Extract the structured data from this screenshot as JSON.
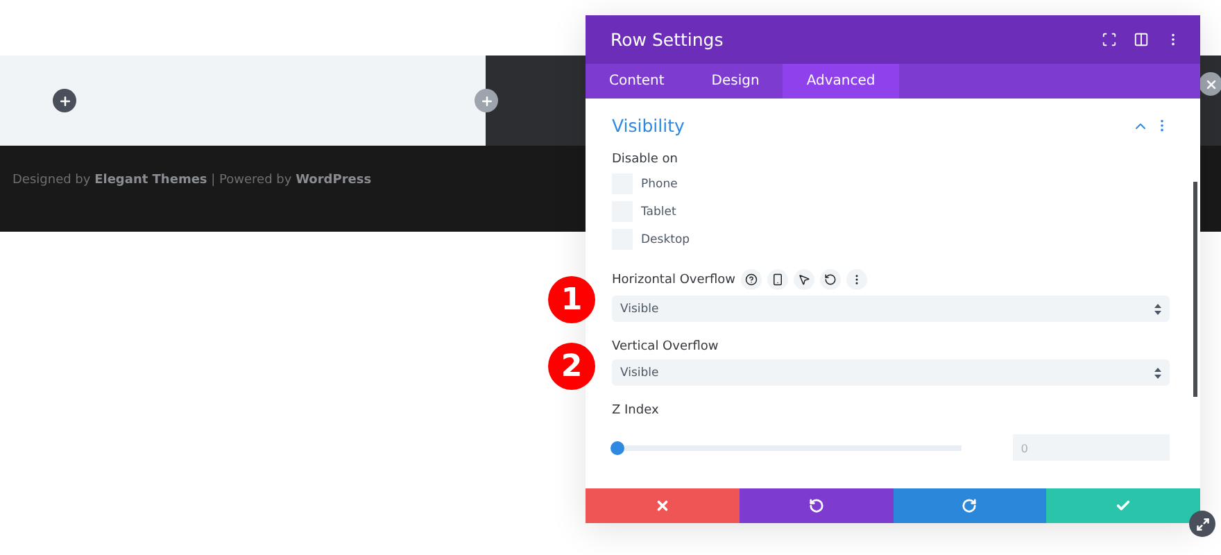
{
  "page": {
    "footer_text": "Designed by **Elegant Themes** | Powered by **WordPress**"
  },
  "modal": {
    "title": "Row Settings",
    "tabs": [
      {
        "label": "Content",
        "selected": false
      },
      {
        "label": "Design",
        "selected": false
      },
      {
        "label": "Advanced",
        "selected": true
      }
    ],
    "section": {
      "title": "Visibility",
      "expanded": true
    },
    "disable_on": {
      "label": "Disable on",
      "options": [
        {
          "label": "Phone",
          "checked": false
        },
        {
          "label": "Tablet",
          "checked": false
        },
        {
          "label": "Desktop",
          "checked": false
        }
      ]
    },
    "fields": [
      {
        "label": "Horizontal Overflow",
        "value": "Visible",
        "marker": "1",
        "tools": true
      },
      {
        "label": "Vertical Overflow",
        "value": "Visible",
        "marker": "2",
        "tools": false
      }
    ],
    "z_index": {
      "label": "Z Index",
      "level": 0,
      "value": "0"
    }
  }
}
